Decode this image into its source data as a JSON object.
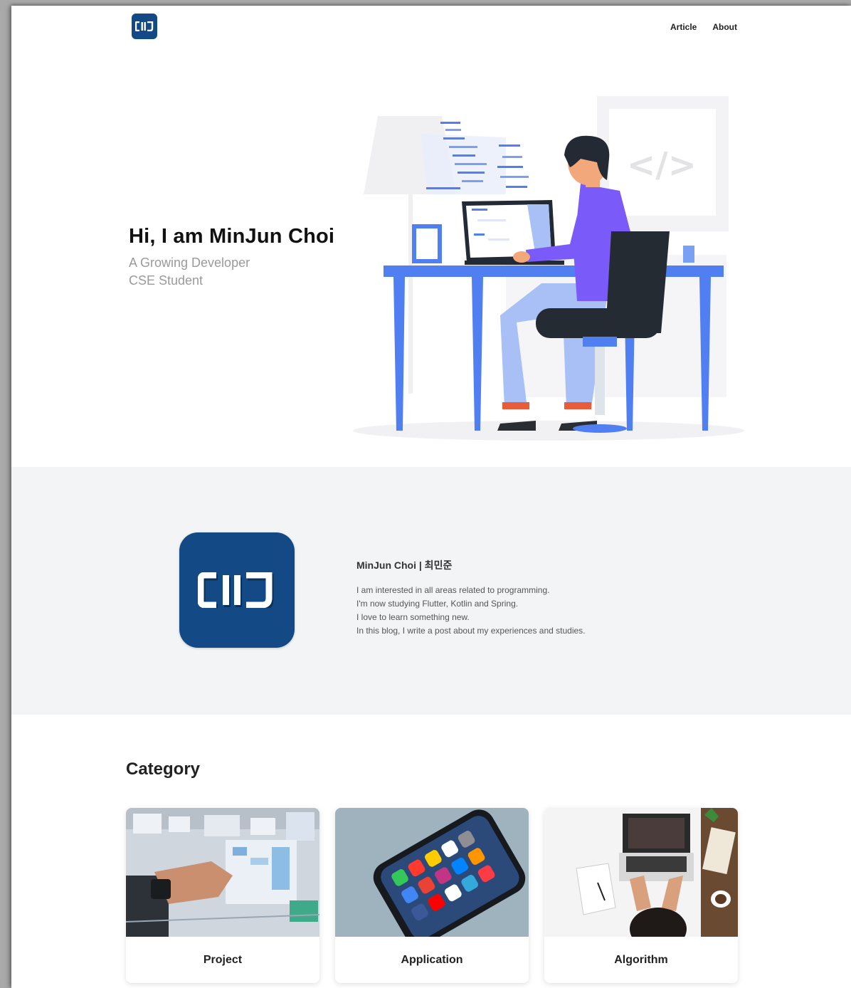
{
  "nav": {
    "logo_text": "CIIIJ",
    "links": [
      {
        "label": "Article"
      },
      {
        "label": "About"
      }
    ]
  },
  "hero": {
    "title": "Hi, I am MinJun Choi",
    "subtitle_lines": [
      "A Growing Developer",
      "CSE Student"
    ],
    "illustration": "developer-at-desk-illustration",
    "code_sign": "</>"
  },
  "about": {
    "logo_text": "CIIIJ",
    "name": "MinJun Choi | 최민준",
    "lines": [
      "I am interested in all areas related to programming.",
      "I'm now studying Flutter, Kotlin and Spring.",
      "I love to learn something new.",
      "In this blog, I write a post about my experiences and studies."
    ]
  },
  "category": {
    "title": "Category",
    "cards": [
      {
        "label": "Project",
        "image": "whiteboard-planning-photo"
      },
      {
        "label": "Application",
        "image": "smartphone-apps-photo"
      },
      {
        "label": "Algorithm",
        "image": "laptop-desk-photo"
      }
    ]
  },
  "colors": {
    "brand_navy": "#134a86",
    "accent_blue": "#4f7ff0",
    "purple": "#7a5af8",
    "about_bg": "#f3f4f6"
  }
}
